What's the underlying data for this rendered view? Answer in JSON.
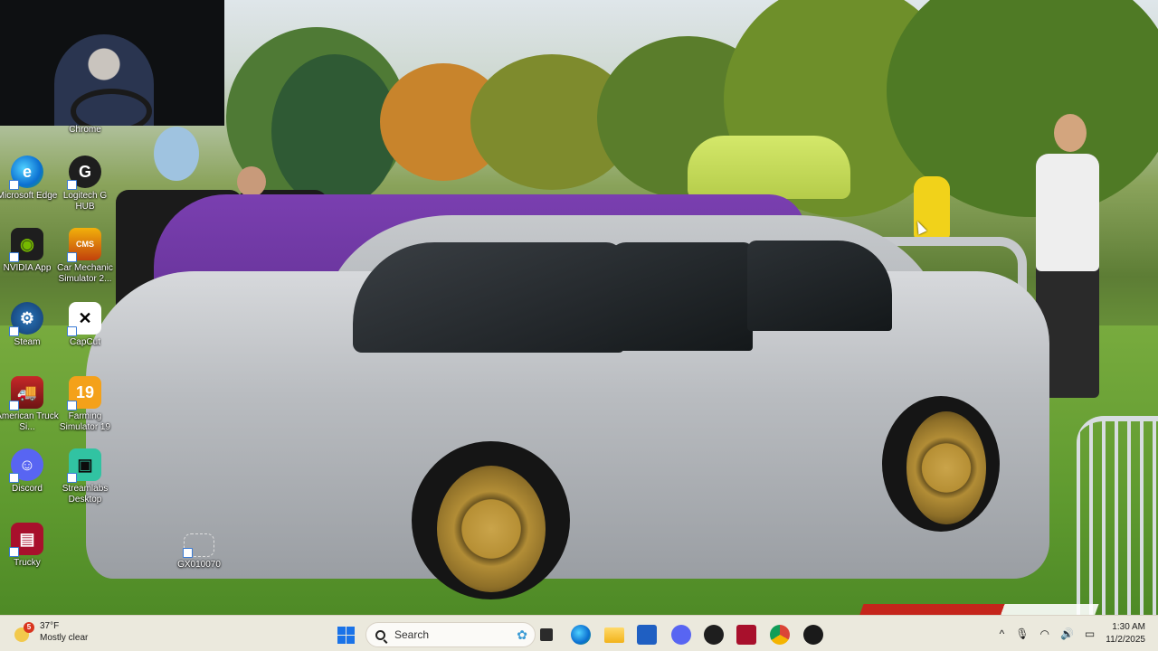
{
  "desktop": {
    "icons": [
      {
        "label": "Chrome",
        "name": "chrome-desktop-icon"
      },
      {
        "label": "Microsoft Edge",
        "name": "edge-desktop-icon"
      },
      {
        "label": "Logitech G HUB",
        "name": "logitech-ghub-desktop-icon"
      },
      {
        "label": "NVIDIA App",
        "name": "nvidia-app-desktop-icon"
      },
      {
        "label": "Car Mechanic Simulator 2...",
        "name": "car-mechanic-simulator-desktop-icon"
      },
      {
        "label": "Steam",
        "name": "steam-desktop-icon"
      },
      {
        "label": "CapCut",
        "name": "capcut-desktop-icon"
      },
      {
        "label": "American Truck Si...",
        "name": "american-truck-simulator-desktop-icon"
      },
      {
        "label": "Farming Simulator 19",
        "name": "farming-simulator-desktop-icon"
      },
      {
        "label": "Discord",
        "name": "discord-desktop-icon"
      },
      {
        "label": "Streamlabs Desktop",
        "name": "streamlabs-desktop-icon"
      },
      {
        "label": "Trucky",
        "name": "trucky-desktop-icon"
      },
      {
        "label": "GX010070",
        "name": "gx010070-file-icon"
      }
    ]
  },
  "taskbar": {
    "weather": {
      "badge": "5",
      "temp": "37°F",
      "condition": "Mostly clear"
    },
    "search": {
      "placeholder": "Search"
    },
    "clock": {
      "time": "1:30 AM",
      "date": "11/2/2025"
    },
    "tray": {
      "chevron": "^"
    }
  },
  "colors": {
    "taskbar_bg": "#f0ece4",
    "accent": "#1a73e8"
  }
}
